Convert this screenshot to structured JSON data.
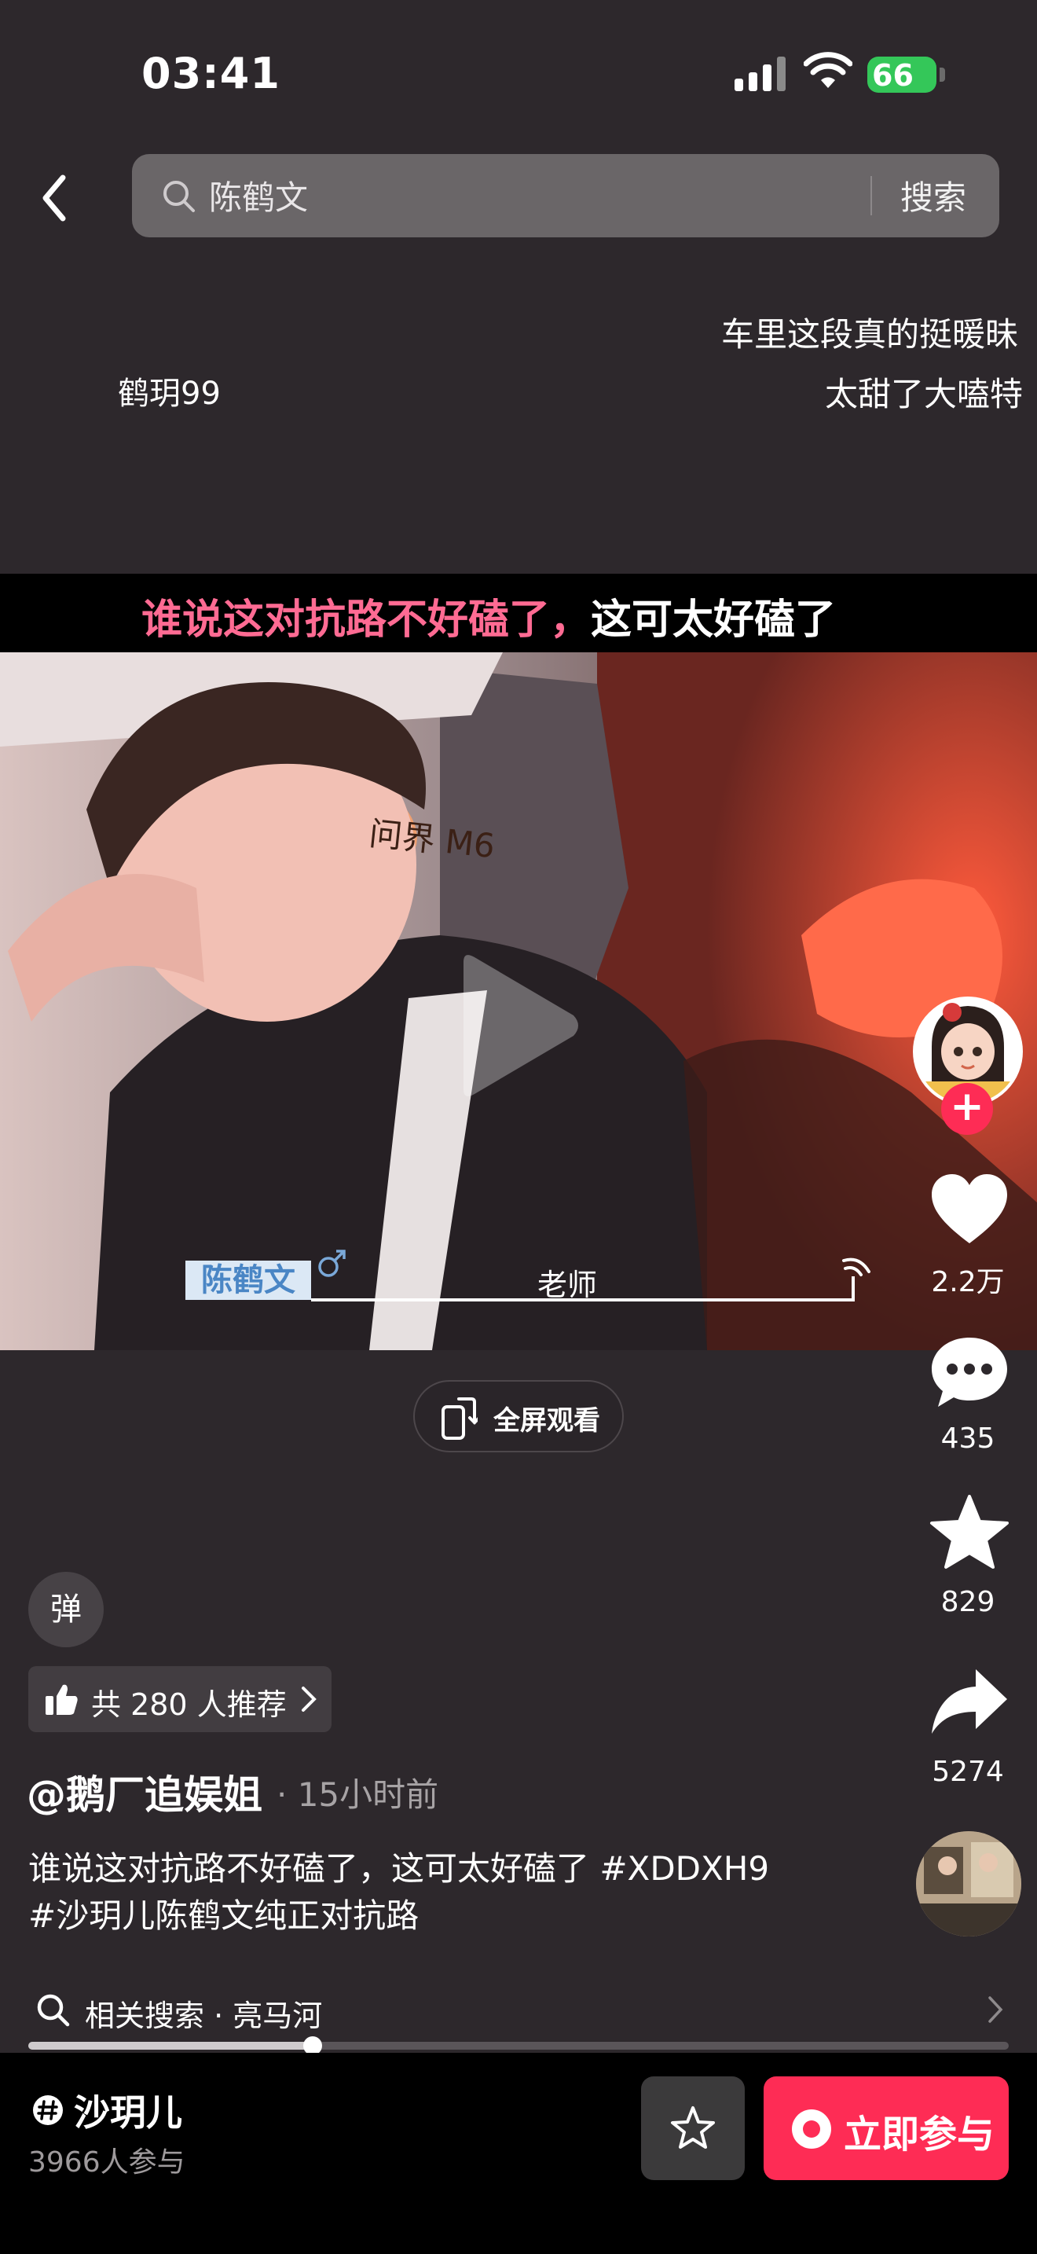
{
  "status_bar": {
    "time": "03:41",
    "battery": "66"
  },
  "search": {
    "query": "陈鹤文",
    "button_label": "搜索"
  },
  "danmu": [
    "车里这段真的挺暖昧",
    "鹤玥99",
    "太甜了大嗑特"
  ],
  "caption": {
    "pink_part": "谁说这对抗路不好磕了，",
    "white_part": "这可太好磕了"
  },
  "video": {
    "pillow_text": "问界 M6",
    "person_tag": "陈鹤文",
    "person_subtitle": "老师",
    "fullscreen_label": "全屏观看"
  },
  "rail": {
    "likes": "2.2万",
    "comments": "435",
    "favorites": "829",
    "shares": "5274"
  },
  "danmu_toggle_label": "弹",
  "recommend_label": "共 280 人推荐",
  "author": {
    "name": "@鹅厂追娱姐",
    "time": "· 15小时前"
  },
  "description": {
    "line1": "谁说这对抗路不好磕了，这可太好磕了 #XDDXH9",
    "line2": "#沙玥儿陈鹤文纯正对抗路"
  },
  "related_search": "相关搜索 · 亮马河",
  "progress": 0.29,
  "bottom_bar": {
    "topic": "沙玥儿",
    "participants": "3966人参与",
    "join_label": "立即参与"
  },
  "colors": {
    "accent": "#fe2c55",
    "caption_pink": "#ff6b93",
    "battery": "#34c759"
  }
}
